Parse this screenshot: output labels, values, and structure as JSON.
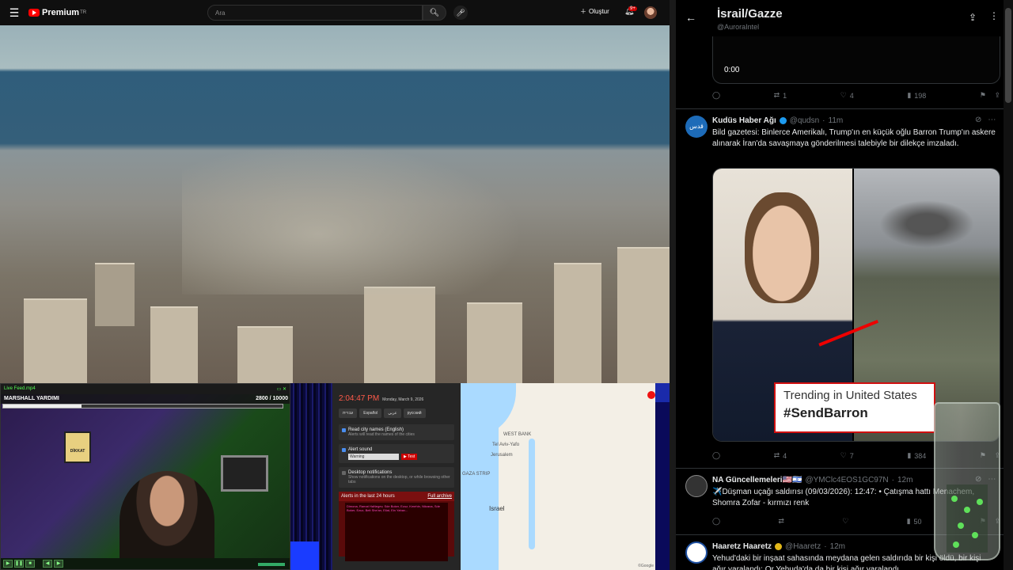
{
  "youtube": {
    "logo_text": "Premium",
    "logo_sup": "TR",
    "search_placeholder": "Ara",
    "create_label": "Oluştur",
    "notification_count": "9+"
  },
  "stream_overlay": {
    "window_title": "Live Feed.mp4",
    "goal_label": "MARSHALL YARDIMI",
    "goal_current": "2800",
    "goal_target": "/ 10000",
    "goal_progress": 0.28,
    "poster_text": "DİKKAT"
  },
  "alert_panel": {
    "time": "2:04:47 PM",
    "date": "Monday, March 9, 2026",
    "languages": [
      "עברית",
      "Español",
      "عربي",
      "русский"
    ],
    "options": [
      {
        "title": "Read city names (English)",
        "desc": "Alerts will read the names of the cities",
        "checked": true
      },
      {
        "title": "Alert sound",
        "desc": "",
        "checked": true
      },
      {
        "title": "Desktop notifications",
        "desc": "Show notifications on the desktop, or while browsing other tabs",
        "checked": false
      }
    ],
    "sound_select": "Warning",
    "test_label": "▶ Test",
    "list_title": "Alerts in the last 24 hours",
    "archive_label": "Full archive",
    "list_text": "Dimona, Ramat HaNegev, Sde Boker, Ezuz, Kmehin, Nitzana, Sde Boker, Ezuz, Beit She'an, Eilat, Ein Yahav..."
  },
  "map": {
    "labels": [
      "Tel Aviv-Yafo",
      "WEST BANK",
      "Jerusalem",
      "GAZA STRIP",
      "Israel"
    ]
  },
  "x": {
    "title": "İsrail/Gazze",
    "handle": "@AuroraIntel",
    "video_time": "0:00",
    "top_actions": {
      "retweets": "1",
      "likes": "4",
      "views": "198"
    },
    "tweets": [
      {
        "name": "Kudüs Haber Ağı",
        "handle": "@qudsn",
        "time": "11m",
        "avatar_text": "قدس",
        "body": "Bild gazetesi: Binlerce Amerikalı, Trump'ın en küçük oğlu Barron Trump'ın askere alınarak İran'da savaşmaya gönderilmesi talebiyle bir dilekçe imzaladı.",
        "image_trend_line1": "Trending in United States",
        "image_trend_line2": "#SendBarron",
        "retweets": "4",
        "likes": "7",
        "views": "384"
      },
      {
        "name": "NA Güncellemeleri🇺🇸🇮🇱",
        "handle": "@YMClc4EOS1GC97N",
        "time": "12m",
        "body": "✈️Düşman uçağı saldırısı (09/03/2026): 12:47: • Çatışma hattı Menachem, Shomra Zofar - kırmızı renk",
        "views": "50"
      },
      {
        "name": "Haaretz Haaretz",
        "handle": "@Haaretz",
        "time": "12m",
        "body": "Yehud'daki bir inşaat sahasında meydana gelen saldırıda bir kişi öldü, bir kişi ağır yaralandı; Or Yehuda'da da bir kişi ağır yaralandı."
      }
    ]
  }
}
